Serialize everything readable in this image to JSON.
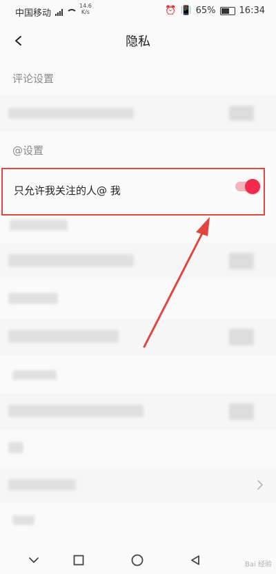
{
  "status_bar": {
    "carrier": "中国移动",
    "speed_value": "14.6",
    "speed_unit": "K/s",
    "battery": "65%",
    "time": "16:34"
  },
  "header": {
    "title": "隐私"
  },
  "sections": {
    "comments": {
      "title": "评论设置"
    },
    "mentions": {
      "title": "@设置"
    }
  },
  "mention_toggle": {
    "label": "只允许我关注的人@ 我",
    "enabled": true
  },
  "colors": {
    "accent": "#f12b4e",
    "annotation": "#e0453e"
  },
  "watermark": "Bai 经验"
}
